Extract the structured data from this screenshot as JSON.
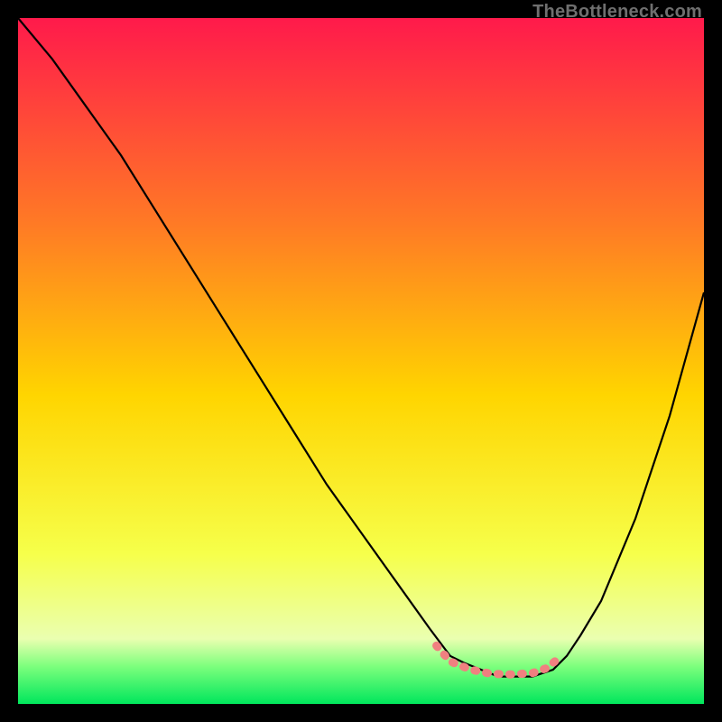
{
  "watermark": "TheBottleneck.com",
  "chart_data": {
    "type": "line",
    "title": "",
    "xlabel": "",
    "ylabel": "",
    "xlim": [
      0,
      100
    ],
    "ylim": [
      0,
      100
    ],
    "grid": false,
    "legend": false,
    "gradient_stops": [
      {
        "offset": 0.0,
        "color": "#ff1a4b"
      },
      {
        "offset": 0.3,
        "color": "#ff7a25"
      },
      {
        "offset": 0.55,
        "color": "#ffd500"
      },
      {
        "offset": 0.78,
        "color": "#f6ff4a"
      },
      {
        "offset": 0.905,
        "color": "#eaffb0"
      },
      {
        "offset": 0.945,
        "color": "#7dff7d"
      },
      {
        "offset": 1.0,
        "color": "#00e65c"
      }
    ],
    "series": [
      {
        "name": "bottleneck-curve",
        "color": "#000000",
        "x": [
          0,
          5,
          10,
          15,
          20,
          25,
          30,
          35,
          40,
          45,
          50,
          55,
          60,
          63,
          65,
          70,
          75,
          78,
          80,
          82,
          85,
          90,
          95,
          100
        ],
        "y": [
          100,
          94,
          87,
          80,
          72,
          64,
          56,
          48,
          40,
          32,
          25,
          18,
          11,
          7,
          6,
          4,
          4,
          5,
          7,
          10,
          15,
          27,
          42,
          60
        ]
      }
    ],
    "highlight_band": {
      "name": "optimal-range",
      "color": "#f08080",
      "x": [
        61,
        63,
        66,
        69,
        72,
        75,
        77,
        79
      ],
      "y": [
        8.5,
        6.2,
        5.0,
        4.4,
        4.3,
        4.5,
        5.2,
        6.8
      ]
    }
  }
}
